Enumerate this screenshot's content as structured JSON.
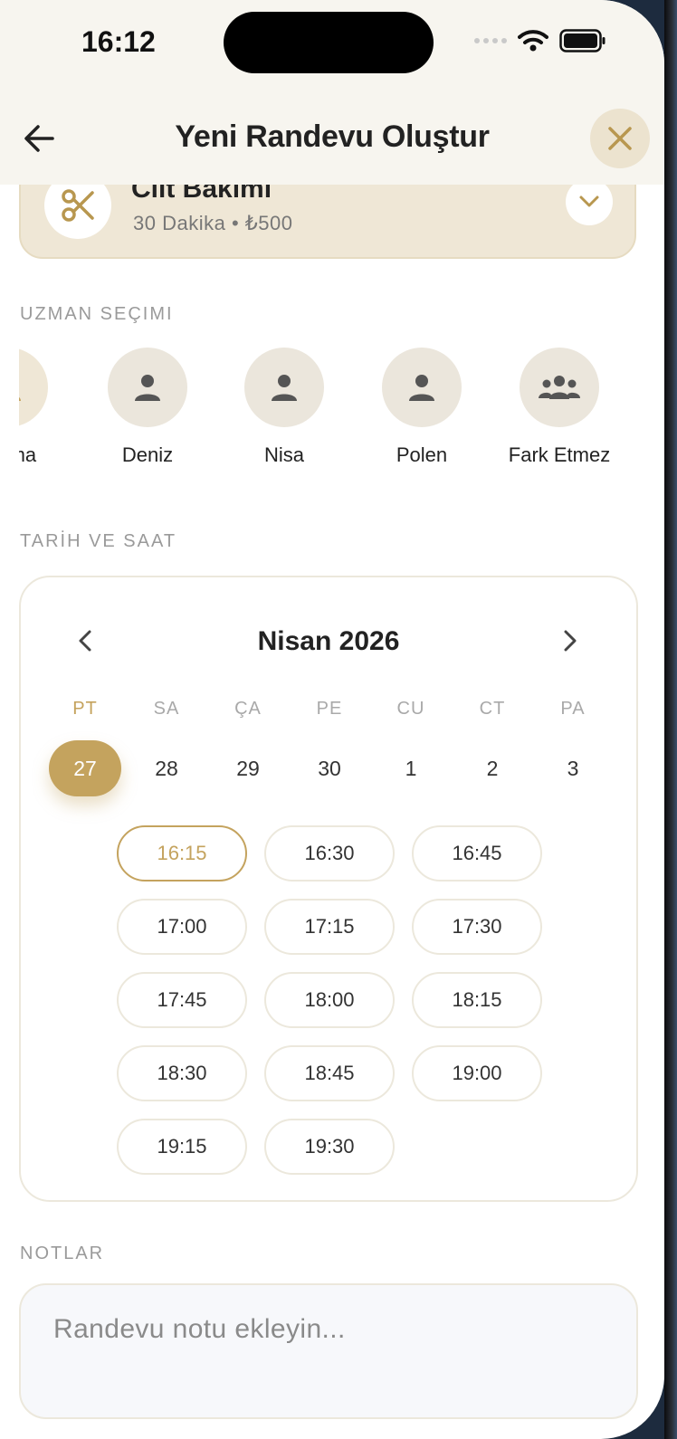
{
  "status_bar": {
    "time": "16:12"
  },
  "header": {
    "title": "Yeni Randevu Oluştur"
  },
  "service": {
    "name": "Cilt Bakımı",
    "meta": "30 Dakika • ₺500"
  },
  "experts_section": {
    "label": "UZMAN SEÇIMI",
    "experts": [
      {
        "name": "Fatma",
        "selected": true
      },
      {
        "name": "Deniz"
      },
      {
        "name": "Nisa"
      },
      {
        "name": "Polen"
      },
      {
        "name": "Fark Etmez"
      }
    ]
  },
  "datetime_section": {
    "label": "TARİH VE SAAT"
  },
  "calendar": {
    "month": "Nisan 2026",
    "weekdays": [
      "PT",
      "SA",
      "ÇA",
      "PE",
      "CU",
      "CT",
      "PA"
    ],
    "days": [
      "27",
      "28",
      "29",
      "30",
      "1",
      "2",
      "3"
    ],
    "selected_day": "27",
    "time_slots": [
      "16:15",
      "16:30",
      "16:45",
      "17:00",
      "17:15",
      "17:30",
      "17:45",
      "18:00",
      "18:15",
      "18:30",
      "18:45",
      "19:00",
      "19:15",
      "19:30"
    ],
    "selected_slot": "16:15"
  },
  "notes_section": {
    "label": "NOTLAR",
    "placeholder": "Randevu notu ekleyin..."
  },
  "colors": {
    "accent": "#c4a35e",
    "header_bg": "#f7f5ef",
    "card_bg": "#efe7d6"
  }
}
